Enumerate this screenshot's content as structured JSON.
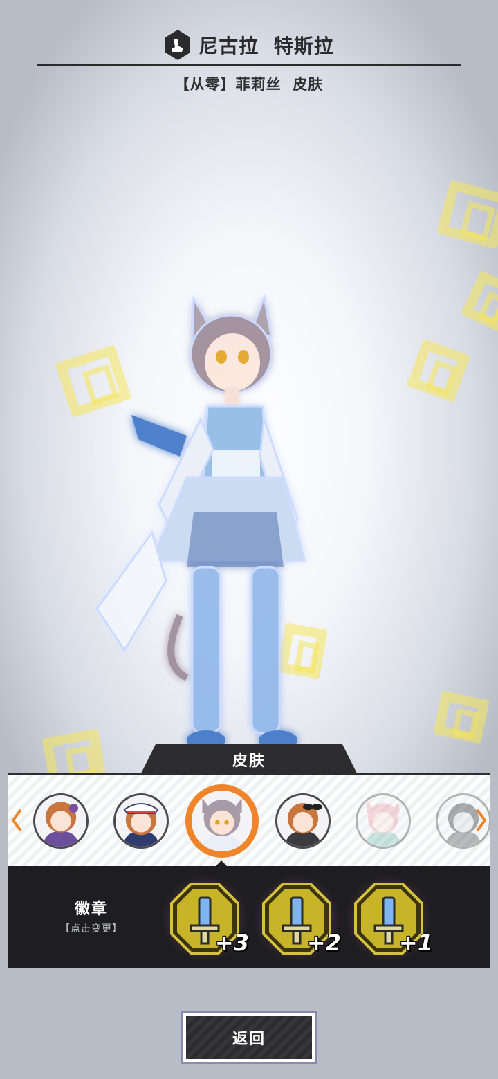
{
  "header": {
    "title": "尼古拉  特斯拉",
    "logo_icon": "hexagon-emblem-icon",
    "subtitle": "【从零】菲莉丝  皮肤"
  },
  "skin_panel": {
    "tab_label": "皮肤",
    "accent_color": "#f0842a",
    "left_arrow_icon": "chevron-left-icon",
    "right_arrow_icon": "chevron-right-icon",
    "skins": [
      {
        "icon": "skin-portrait-icon",
        "state": "normal"
      },
      {
        "icon": "skin-portrait-icon",
        "state": "normal"
      },
      {
        "icon": "skin-portrait-icon",
        "state": "selected"
      },
      {
        "icon": "skin-portrait-icon",
        "state": "normal"
      },
      {
        "icon": "skin-portrait-icon",
        "state": "locked"
      },
      {
        "icon": "skin-portrait-icon",
        "state": "locked"
      }
    ]
  },
  "badge_panel": {
    "label": "徽章",
    "hint": "【点击变更】",
    "badges": [
      {
        "icon": "sword-badge-icon",
        "level": "+3"
      },
      {
        "icon": "sword-badge-icon",
        "level": "+2"
      },
      {
        "icon": "sword-badge-icon",
        "level": "+1"
      }
    ]
  },
  "footer": {
    "back_label": "返回"
  }
}
